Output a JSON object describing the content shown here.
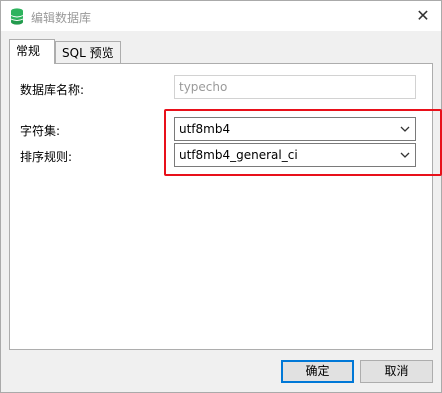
{
  "window": {
    "title": "编辑数据库",
    "close_glyph": "✕"
  },
  "tabs": [
    {
      "label": "常规",
      "active": true
    },
    {
      "label": "SQL 预览",
      "active": false
    }
  ],
  "form": {
    "db_name_label": "数据库名称:",
    "db_name_value": "typecho",
    "charset_label": "字符集:",
    "charset_value": "utf8mb4",
    "collation_label": "排序规则:",
    "collation_value": "utf8mb4_general_ci"
  },
  "buttons": {
    "ok_label": "确定",
    "cancel_label": "取消"
  },
  "icons": {
    "app": "database-icon",
    "dropdown": "chevron-down-icon"
  },
  "colors": {
    "highlight_border": "#e8101a",
    "db_icon": "#2db35d",
    "primary_button_border": "#0078d7"
  }
}
